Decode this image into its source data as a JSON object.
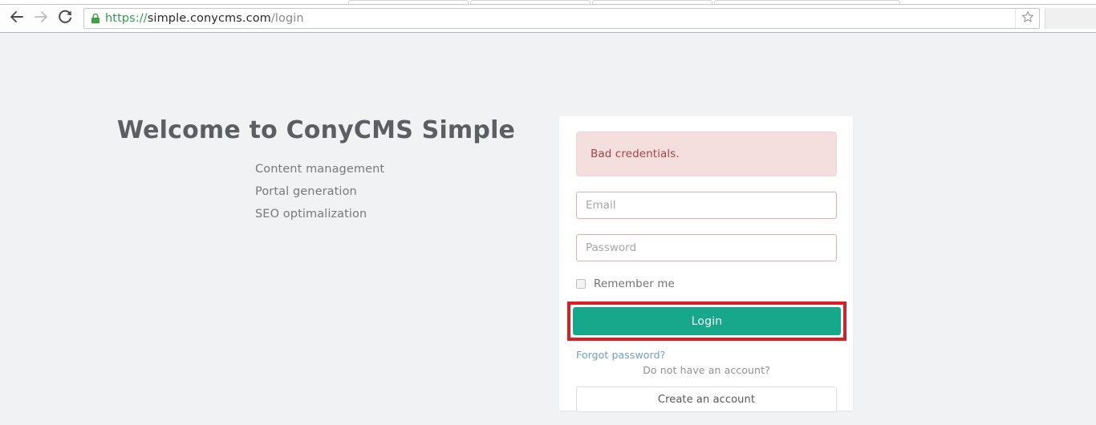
{
  "browser": {
    "back_icon": "back-arrow-icon",
    "forward_icon": "forward-arrow-icon",
    "reload_icon": "reload-icon",
    "lock_icon": "lock-icon",
    "star_icon": "bookmark-star-icon",
    "url": {
      "scheme": "https://",
      "host": "simple.conycms.com",
      "path": "/login"
    },
    "tab_stubs": 4
  },
  "promo": {
    "title": "Welcome to ConyCMS Simple",
    "features": [
      "Content management",
      "Portal generation",
      "SEO optimalization"
    ]
  },
  "login": {
    "alert": "Bad credentials.",
    "email_placeholder": "Email",
    "email_value": "",
    "password_placeholder": "Password",
    "password_value": "",
    "remember_label": "Remember me",
    "remember_checked": false,
    "login_label": "Login",
    "forgot_label": "Forgot password?",
    "no_account_text": "Do not have an account?",
    "create_account_label": "Create an account"
  },
  "colors": {
    "page_background": "#f1f2f4",
    "card_background": "#ffffff",
    "alert_background": "#f4dede",
    "alert_text": "#a94442",
    "input_border_error": "#e5acac",
    "login_button": "#17a88c",
    "annotation_box": "#d81f26",
    "link": "#6e9fc4",
    "heading_text": "#5b5f63",
    "url_scheme": "#2e9e4f"
  }
}
